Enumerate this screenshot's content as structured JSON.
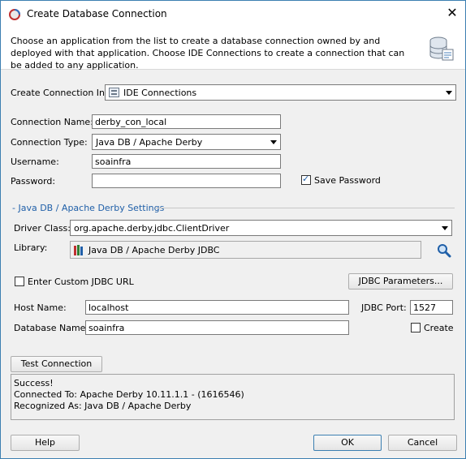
{
  "window": {
    "title": "Create Database Connection",
    "close_glyph": "✕"
  },
  "header": {
    "description": "Choose an application from the list to create a database connection owned by and deployed with that application. Choose IDE Connections to create a connection that can be added to any application.",
    "icon": "database-icon"
  },
  "form": {
    "create_in_label": "Create Connection In:",
    "create_in_value": "IDE Connections",
    "connection_name_label": "Connection Name:",
    "connection_name_value": "derby_con_local",
    "connection_type_label": "Connection Type:",
    "connection_type_value": "Java DB / Apache Derby",
    "username_label": "Username:",
    "username_value": "soainfra",
    "password_label": "Password:",
    "password_value": "",
    "save_password_label": "Save Password",
    "save_password_checked": true
  },
  "settings": {
    "section_title": "- Java DB / Apache Derby Settings",
    "driver_class_label": "Driver Class:",
    "driver_class_value": "org.apache.derby.jdbc.ClientDriver",
    "library_label": "Library:",
    "library_value": "Java DB / Apache Derby JDBC",
    "custom_url_label": "Enter Custom JDBC URL",
    "custom_url_checked": false,
    "jdbc_params_label": "JDBC Parameters...",
    "host_label": "Host Name:",
    "host_value": "localhost",
    "port_label": "JDBC Port:",
    "port_value": "1527",
    "dbname_label": "Database Name:",
    "dbname_value": "soainfra",
    "create_label": "Create",
    "create_checked": false
  },
  "test": {
    "button_label": "Test Connection",
    "status_lines": [
      "Success!",
      "Connected To: Apache Derby 10.11.1.1 - (1616546)",
      "Recognized As: Java DB / Apache Derby"
    ]
  },
  "footer": {
    "help_label": "Help",
    "ok_label": "OK",
    "cancel_label": "Cancel"
  },
  "colors": {
    "accent": "#1f5fa8",
    "window_border": "#3c7fb1"
  }
}
